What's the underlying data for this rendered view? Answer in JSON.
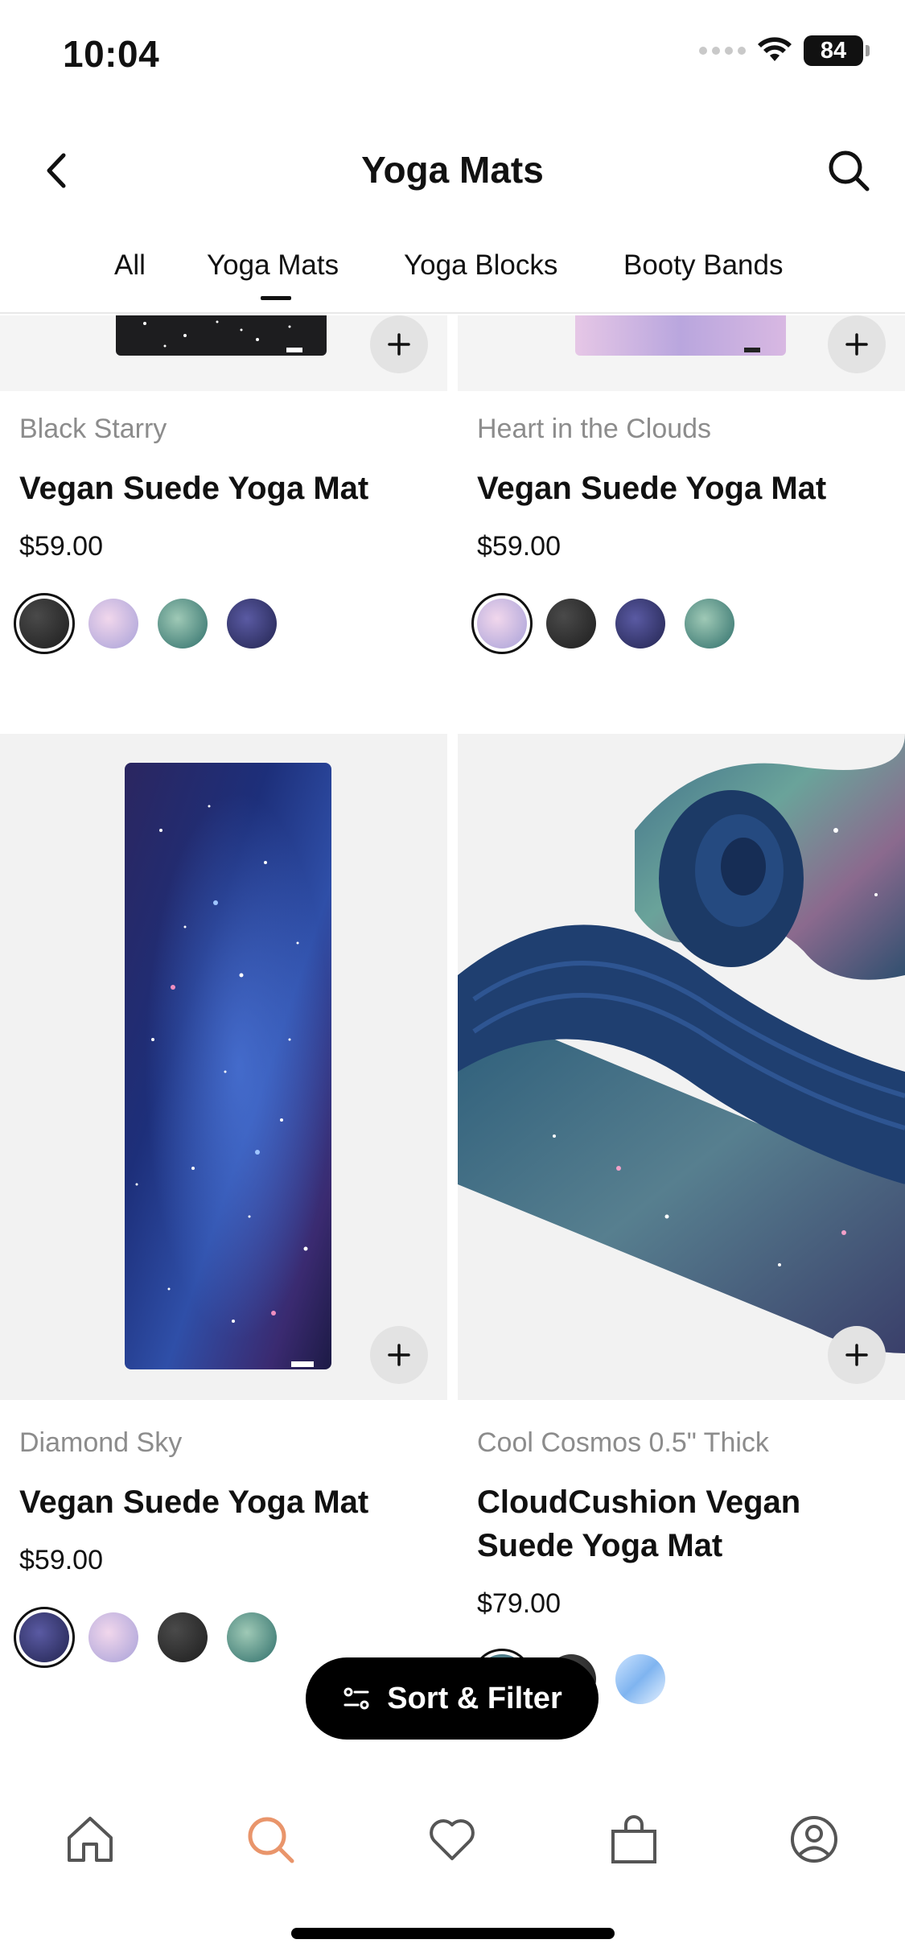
{
  "status_bar": {
    "time": "10:04",
    "battery": "84"
  },
  "header": {
    "title": "Yoga Mats"
  },
  "tabs": [
    {
      "label": "All",
      "active": false
    },
    {
      "label": "Yoga Mats",
      "active": true
    },
    {
      "label": "Yoga Blocks",
      "active": false
    },
    {
      "label": "Booty Bands",
      "active": false
    }
  ],
  "products": [
    {
      "brand": "Black Starry",
      "name": "Vegan Suede Yoga Mat",
      "price": "$59.00",
      "swatches": [
        "black-starry",
        "pink-clouds",
        "green-leaves",
        "navy-galaxy"
      ],
      "selected_swatch": 0
    },
    {
      "brand": "Heart in the Clouds",
      "name": "Vegan Suede Yoga Mat",
      "price": "$59.00",
      "swatches": [
        "pink-clouds",
        "black-starry",
        "navy-galaxy",
        "green-leaves"
      ],
      "selected_swatch": 0
    },
    {
      "brand": "Diamond Sky",
      "name": "Vegan Suede Yoga Mat",
      "price": "$59.00",
      "swatches": [
        "navy-galaxy",
        "pink-clouds",
        "black-starry",
        "green-leaves"
      ],
      "selected_swatch": 0
    },
    {
      "brand": "Cool Cosmos 0.5\" Thick",
      "name": "CloudCushion Vegan Suede Yoga Mat",
      "price": "$79.00",
      "swatches": [
        "cool-cosmos",
        "black-starry",
        "iridescent-blue"
      ],
      "selected_swatch": 0
    }
  ],
  "sort_filter": {
    "label": "Sort & Filter"
  },
  "bottom_nav": [
    {
      "icon": "home-icon",
      "active": false
    },
    {
      "icon": "search-icon",
      "active": true
    },
    {
      "icon": "heart-icon",
      "active": false
    },
    {
      "icon": "bag-icon",
      "active": false
    },
    {
      "icon": "profile-icon",
      "active": false
    }
  ],
  "colors": {
    "accent": "#e9956b",
    "text": "#111111",
    "muted": "#8c8c8c",
    "button_bg": "#000000"
  }
}
